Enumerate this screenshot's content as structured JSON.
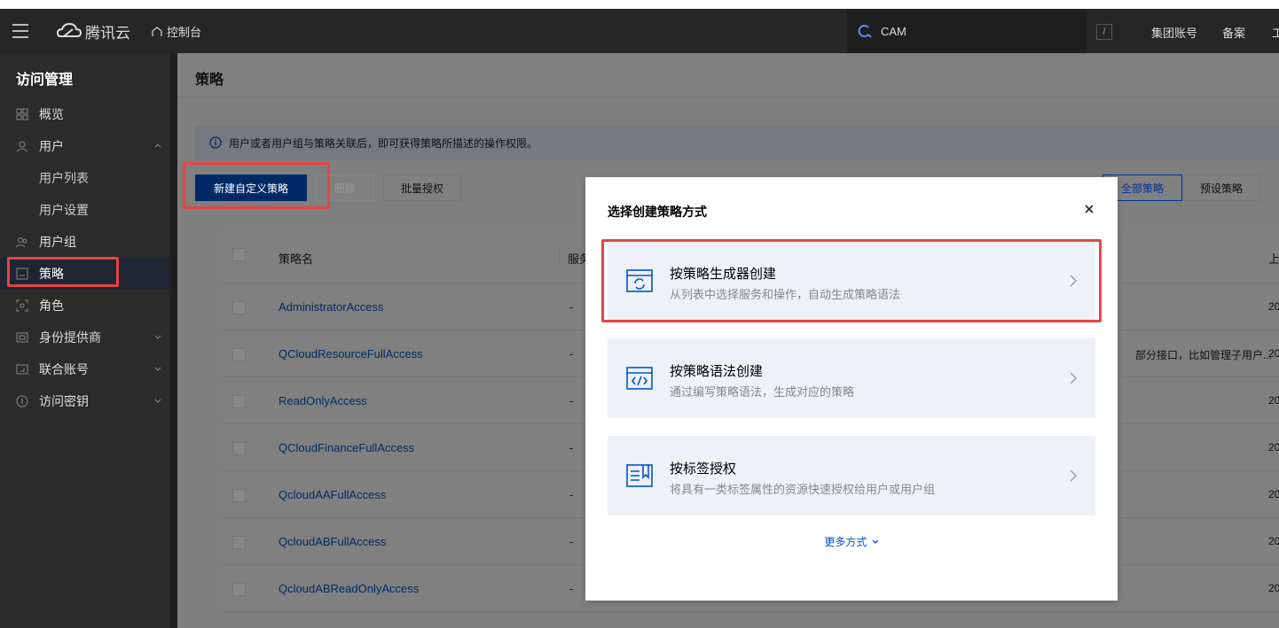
{
  "header": {
    "brand": "腾讯云",
    "console": "控制台",
    "search_text": "CAM",
    "slash": "/",
    "links": [
      "集团账号",
      "备案",
      "工"
    ]
  },
  "sidebar": {
    "title": "访问管理",
    "items": [
      {
        "label": "概览"
      },
      {
        "label": "用户"
      },
      {
        "label": "用户列表"
      },
      {
        "label": "用户设置"
      },
      {
        "label": "用户组"
      },
      {
        "label": "策略"
      },
      {
        "label": "角色"
      },
      {
        "label": "身份提供商"
      },
      {
        "label": "联合账号"
      },
      {
        "label": "访问密钥"
      }
    ]
  },
  "main": {
    "title": "策略",
    "info": "用户或者用户组与策略关联后，即可获得策略所描述的操作权限。",
    "buttons": {
      "create": "新建自定义策略",
      "delete": "删除",
      "batch": "批量授权"
    },
    "filters": {
      "all": "全部策略",
      "preset": "预设策略"
    },
    "table": {
      "headers": {
        "name": "策略名",
        "service": "服务",
        "updated": "上"
      },
      "rows": [
        {
          "name": "AdministratorAccess",
          "service": "-",
          "desc": "",
          "date": "20"
        },
        {
          "name": "QCloudResourceFullAccess",
          "service": "-",
          "desc": "部分接口，比如管理子用户...",
          "date": "20"
        },
        {
          "name": "ReadOnlyAccess",
          "service": "-",
          "desc": "",
          "date": "20"
        },
        {
          "name": "QCloudFinanceFullAccess",
          "service": "-",
          "desc": "",
          "date": "20"
        },
        {
          "name": "QcloudAAFullAccess",
          "service": "-",
          "desc": "",
          "date": "20"
        },
        {
          "name": "QcloudABFullAccess",
          "service": "-",
          "desc": "",
          "date": "20"
        },
        {
          "name": "QcloudABReadOnlyAccess",
          "service": "-",
          "desc": "",
          "date": "20"
        }
      ]
    }
  },
  "modal": {
    "title": "选择创建策略方式",
    "options": [
      {
        "title": "按策略生成器创建",
        "subtitle": "从列表中选择服务和操作，自动生成策略语法"
      },
      {
        "title": "按策略语法创建",
        "subtitle": "通过编写策略语法，生成对应的策略"
      },
      {
        "title": "按标签授权",
        "subtitle": "将具有一类标签属性的资源快速授权给用户或用户组"
      }
    ],
    "more": "更多方式"
  },
  "colors": {
    "accent": "#0052d9",
    "highlight": "#e54545",
    "header_bg": "#262626",
    "sidebar_bg": "#2b2b2b"
  }
}
